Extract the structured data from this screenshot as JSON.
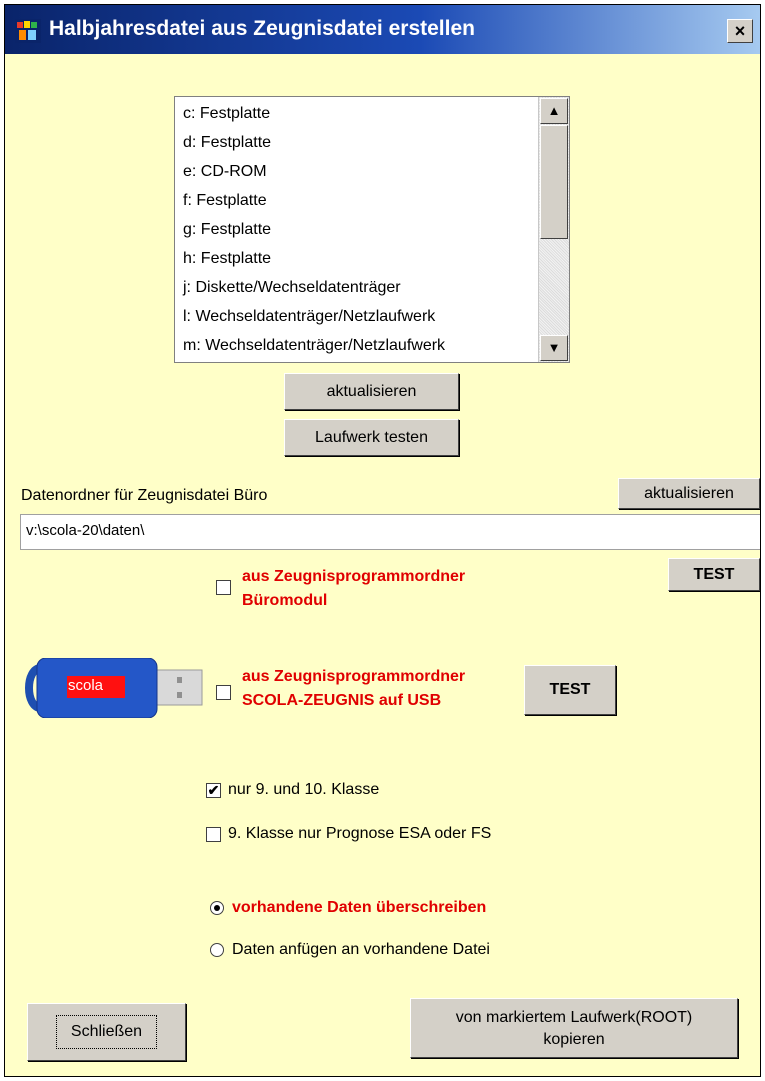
{
  "window": {
    "title": "Halbjahresdatei aus Zeugnisdatei erstellen",
    "close_label": "×"
  },
  "drives": [
    "c:  Festplatte",
    "d:  Festplatte",
    "e:  CD-ROM",
    "f:  Festplatte",
    "g:  Festplatte",
    "h:  Festplatte",
    "j:  Diskette/Wechseldatenträger",
    "l:  Wechseldatenträger/Netzlaufwerk",
    "m:  Wechseldatenträger/Netzlaufwerk"
  ],
  "buttons": {
    "refresh_drives": "aktualisieren",
    "test_drive": "Laufwerk testen",
    "refresh_folder": "aktualisieren",
    "test_buero": "TEST",
    "test_usb": "TEST",
    "close": "Schließen",
    "copy_line1": "von markiertem Laufwerk(ROOT)",
    "copy_line2": "kopieren"
  },
  "folder": {
    "label": "Datenordner für Zeugnisdatei Büro",
    "value": "v:\\scola-20\\daten\\"
  },
  "options": {
    "buero_line1": "aus Zeugnisprogrammordner",
    "buero_line2": "Büromodul",
    "buero_checked": false,
    "usb_line1": "aus Zeugnisprogrammordner",
    "usb_line2": "SCOLA-ZEUGNIS auf USB",
    "usb_checked": false,
    "usb_stick_label": "scola",
    "class_9_10": "nur 9. und 10. Klasse",
    "class_9_10_checked": true,
    "prognose": "9. Klasse nur Prognose ESA oder FS",
    "prognose_checked": false,
    "overwrite": "vorhandene Daten überschreiben",
    "overwrite_selected": true,
    "append": "Daten anfügen an vorhandene Datei",
    "append_selected": false
  },
  "colors": {
    "background": "#ffffc8",
    "accent_red": "#e00000",
    "titlebar": "#0a246a"
  },
  "icons": {
    "scroll_up": "▲",
    "scroll_down": "▼",
    "check": "✔"
  }
}
